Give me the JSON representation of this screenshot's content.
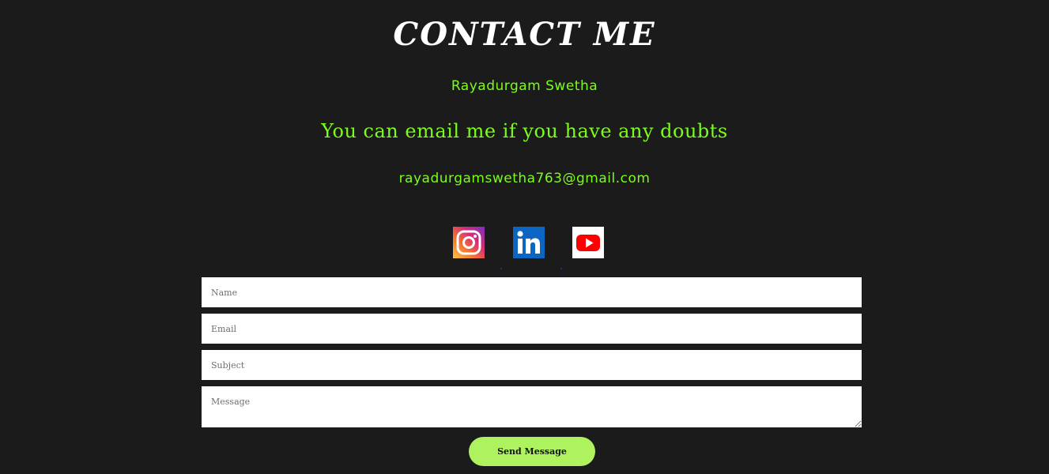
{
  "header": {
    "title": "CONTACT ME",
    "name": "Rayadurgam Swetha",
    "tagline": "You can email me if you have any doubts",
    "email": "rayadurgamswetha763@gmail.com"
  },
  "socials": [
    {
      "icon": "instagram-icon",
      "color": "#e1306c"
    },
    {
      "icon": "linkedin-icon",
      "color": "#0a66c2"
    },
    {
      "icon": "youtube-icon",
      "color": "#ff0000"
    }
  ],
  "form": {
    "name_placeholder": "Name",
    "email_placeholder": "Email",
    "subject_placeholder": "Subject",
    "message_placeholder": "Message",
    "submit_label": "Send Message"
  },
  "colors": {
    "background": "#1b1b1b",
    "accent_text": "#7cfc1a",
    "button": "#aef25f"
  }
}
